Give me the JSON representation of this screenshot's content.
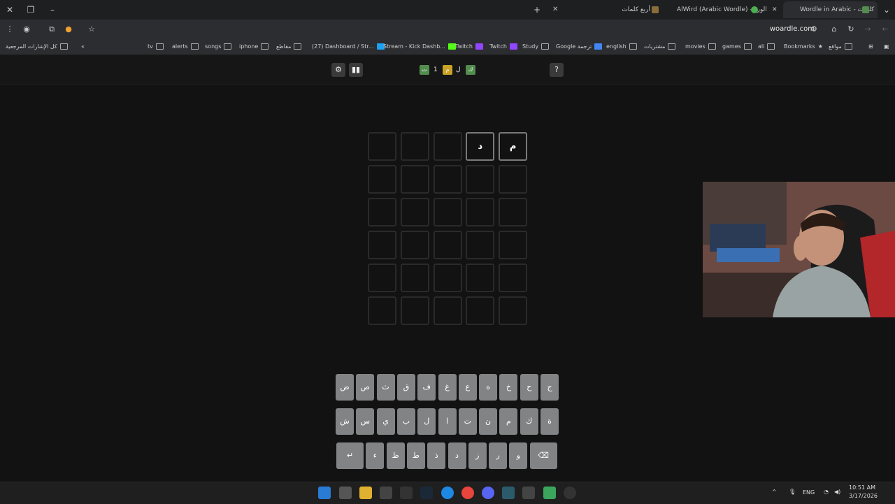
{
  "tabs": [
    {
      "title": "Wordle in Arabic - كلمات",
      "active": true
    },
    {
      "title": "AlWird (Arabic Wordle) - الورد",
      "active": false
    },
    {
      "title": "أربع كلمات",
      "active": false
    }
  ],
  "toolbar": {
    "url": "woardle.com"
  },
  "bookmarks": [
    "كل الإشارات المرجعية",
    "tv",
    "alerts",
    "songs",
    "iphone",
    "مقاطع",
    "(27) Dashboard / Str...",
    "Stream - Kick Dashb...",
    "Twitch",
    "Twitch",
    "Study",
    "Google ترجمة",
    "english",
    "مشتريات",
    "movies",
    "games",
    "ali",
    "Bookmarks",
    "مواقع"
  ],
  "game": {
    "logo": {
      "tiles": [
        "ك",
        "ل",
        "م",
        "1",
        "ت"
      ]
    },
    "board": [
      [
        "",
        "",
        "",
        "د",
        "م"
      ],
      [
        "",
        "",
        "",
        "",
        ""
      ],
      [
        "",
        "",
        "",
        "",
        ""
      ],
      [
        "",
        "",
        "",
        "",
        ""
      ],
      [
        "",
        "",
        "",
        "",
        ""
      ],
      [
        "",
        "",
        "",
        "",
        ""
      ]
    ],
    "keyboard": {
      "row1": [
        "ض",
        "ص",
        "ث",
        "ق",
        "ف",
        "غ",
        "ع",
        "ه",
        "خ",
        "ح",
        "ج"
      ],
      "row2": [
        "ش",
        "س",
        "ي",
        "ب",
        "ل",
        "ا",
        "ت",
        "ن",
        "م",
        "ك",
        "ة"
      ],
      "row3": [
        "↵",
        "ء",
        "ظ",
        "ط",
        "ذ",
        "د",
        "ز",
        "ر",
        "و",
        "⌫"
      ]
    }
  },
  "taskbar": {
    "lang": "ENG",
    "time": "10:51 AM",
    "date": "3/17/2026"
  },
  "colors": {
    "correct": "#538d4e",
    "present": "#c9a227",
    "key": "#818384",
    "bg": "#121212"
  }
}
